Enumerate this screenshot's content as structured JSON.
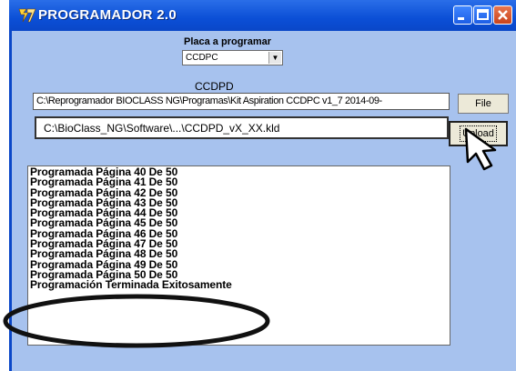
{
  "window": {
    "title": "PROGRAMADOR 2.0",
    "icons": {
      "app": "app-logo-icon",
      "minimize": "minimize-icon",
      "maximize": "maximize-icon",
      "close": "close-icon"
    }
  },
  "board": {
    "label": "Placa a programar",
    "selected": "CCDPC"
  },
  "file_section": {
    "label": "CCDPD",
    "path": "C:\\Reprogramador BIOCLASS NG\\Programas\\Kit Aspiration CCDPC v1_7 2014-09-",
    "file_button": "File"
  },
  "upload_section": {
    "path": "C:\\BioClass_NG\\Software\\...\\CCDPD_vX_XX.kld",
    "upload_button": "Upload"
  },
  "log": [
    "Programada Página 40 De 50",
    "Programada Página 41 De 50",
    "Programada Página 42 De 50",
    "Programada Página 43 De 50",
    "Programada Página 44 De 50",
    "Programada Página 45 De 50",
    "Programada Página 46 De 50",
    "Programada Página 47 De 50",
    "Programada Página 48 De 50",
    "Programada Página 49 De 50",
    "Programada Página 50 De 50",
    "Programación Terminada Exitosamente"
  ],
  "annotations": {
    "cursor": "mouse-pointer-icon",
    "highlight": "highlight-ellipse"
  },
  "colors": {
    "titlebar": "#0b4fd6",
    "window_bg": "#a7c2ee",
    "close_button": "#c9431c"
  }
}
